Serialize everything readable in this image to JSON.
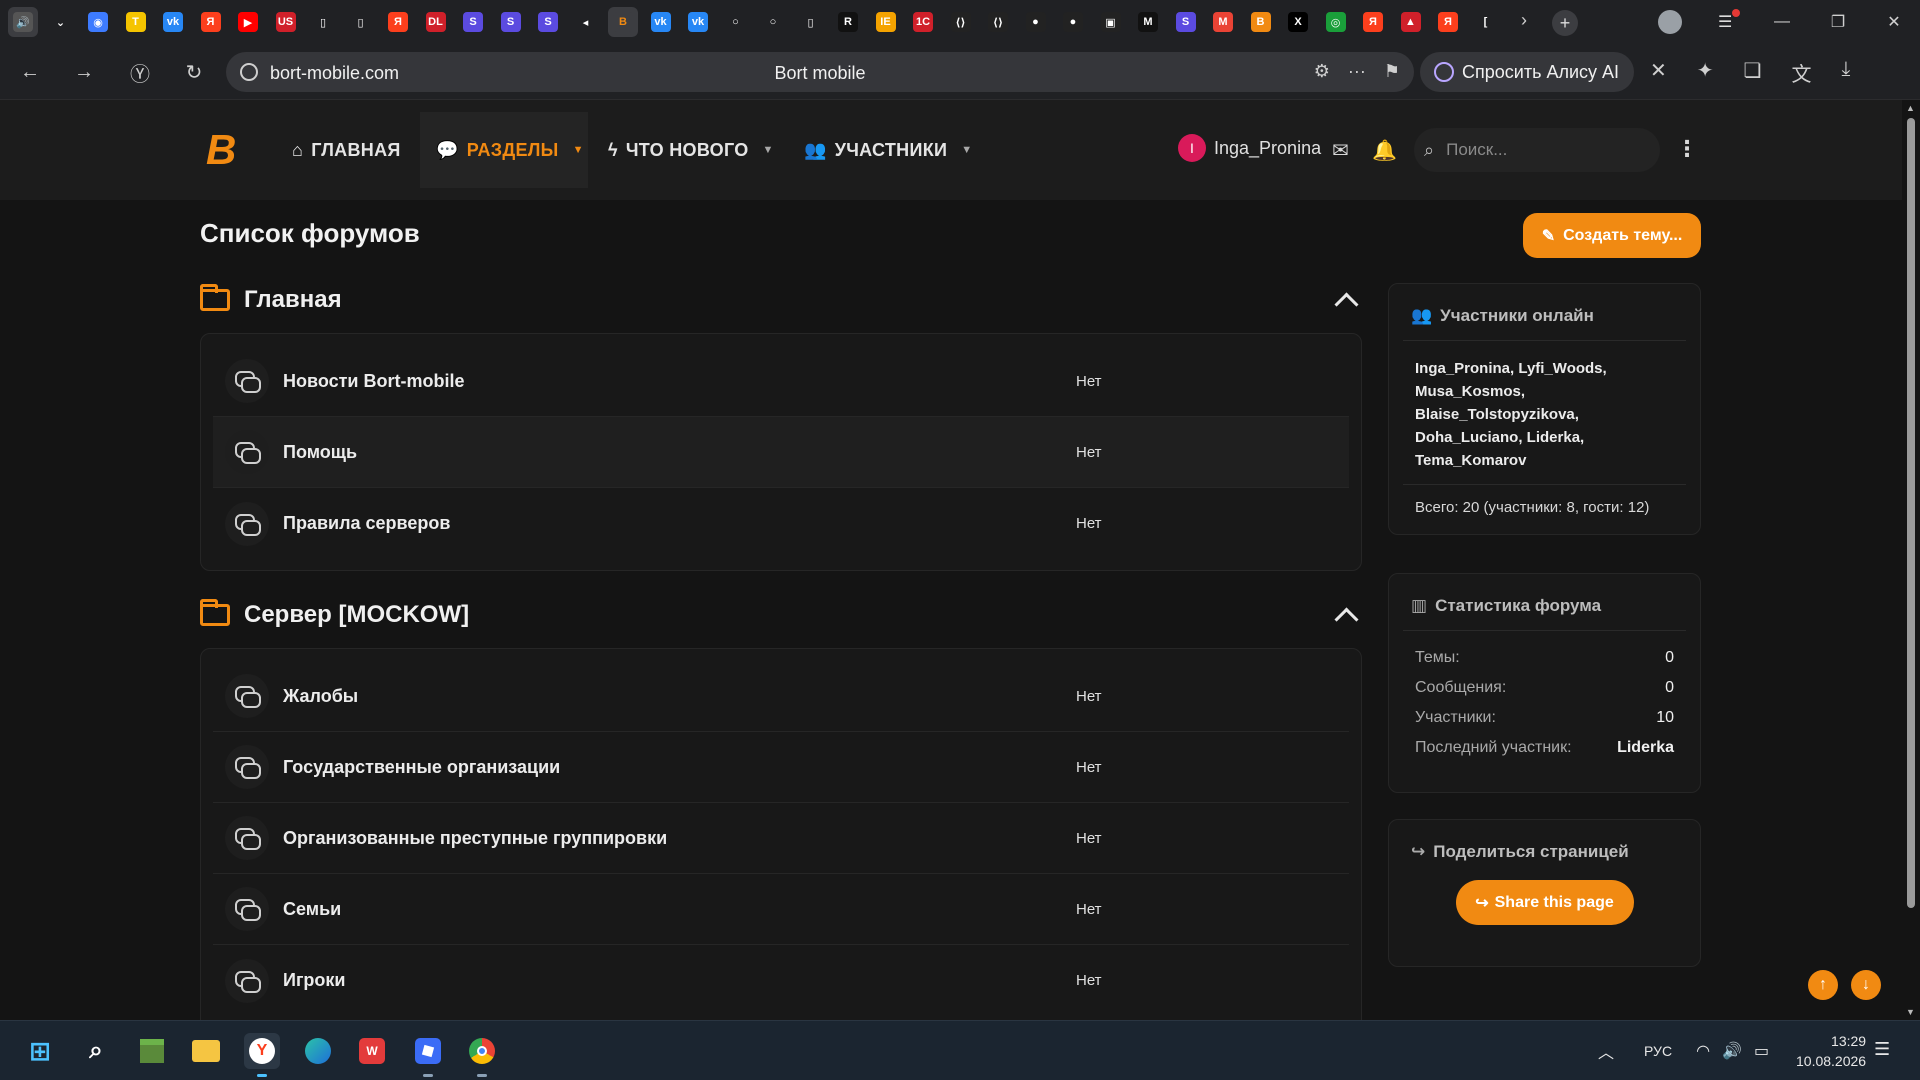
{
  "browser": {
    "url": "bort-mobile.com",
    "page_title": "Bort mobile",
    "alice_label": "Спросить Алису AI",
    "tabs": [
      {
        "icon": "speaker-tab-icon",
        "glyph": "🔊",
        "color": "#555"
      },
      {
        "icon": "tab-list-icon",
        "glyph": "⌄",
        "color": "transparent"
      },
      {
        "icon": "photo-app-icon",
        "glyph": "◉",
        "color": "#3d7bff"
      },
      {
        "icon": "t-app-icon",
        "glyph": "T",
        "color": "#f5c400"
      },
      {
        "icon": "vk-icon",
        "glyph": "vk",
        "color": "#2787f5"
      },
      {
        "icon": "yandex-icon",
        "glyph": "Я",
        "color": "#fc3f1d"
      },
      {
        "icon": "youtube-icon",
        "glyph": "▶",
        "color": "#ff0000"
      },
      {
        "icon": "us-icon",
        "glyph": "US",
        "color": "#d0202a"
      },
      {
        "icon": "doc-icon",
        "glyph": "▯",
        "color": "transparent"
      },
      {
        "icon": "doc-icon",
        "glyph": "▯",
        "color": "transparent"
      },
      {
        "icon": "yandex-icon",
        "glyph": "Я",
        "color": "#fc3f1d"
      },
      {
        "icon": "dl-icon",
        "glyph": "DL",
        "color": "#d0202a"
      },
      {
        "icon": "s-app-icon",
        "glyph": "S",
        "color": "#5b4be0"
      },
      {
        "icon": "s-app-icon",
        "glyph": "S",
        "color": "#5b4be0"
      },
      {
        "icon": "s-app-icon",
        "glyph": "S",
        "color": "#5b4be0"
      },
      {
        "icon": "audio-icon",
        "glyph": "◂",
        "color": "transparent"
      },
      {
        "icon": "bort-icon",
        "glyph": "B",
        "color": "#3c3d41"
      },
      {
        "icon": "vk-icon",
        "glyph": "vk",
        "color": "#2787f5"
      },
      {
        "icon": "vk-icon",
        "glyph": "vk",
        "color": "#2787f5"
      },
      {
        "icon": "loader-icon",
        "glyph": "○",
        "color": "transparent"
      },
      {
        "icon": "loader-icon",
        "glyph": "○",
        "color": "transparent"
      },
      {
        "icon": "doc-icon",
        "glyph": "▯",
        "color": "transparent"
      },
      {
        "icon": "r-icon",
        "glyph": "R",
        "color": "#111"
      },
      {
        "icon": "ie-icon",
        "glyph": "IE",
        "color": "#f5a300"
      },
      {
        "icon": "1c-icon",
        "glyph": "1C",
        "color": "#d0202a"
      },
      {
        "icon": "code-icon",
        "glyph": "⟨⟩",
        "color": "#222"
      },
      {
        "icon": "code-icon",
        "glyph": "⟨⟩",
        "color": "#222"
      },
      {
        "icon": "github-icon",
        "glyph": "●",
        "color": "#222"
      },
      {
        "icon": "github-icon",
        "glyph": "●",
        "color": "#222"
      },
      {
        "icon": "terminal-icon",
        "glyph": "▣",
        "color": "#222"
      },
      {
        "icon": "m-icon",
        "glyph": "M",
        "color": "#111"
      },
      {
        "icon": "s-app-icon",
        "glyph": "S",
        "color": "#5b4be0"
      },
      {
        "icon": "gmail-icon",
        "glyph": "M",
        "color": "#ea4335"
      },
      {
        "icon": "b-icon",
        "glyph": "B",
        "color": "#f18a12"
      },
      {
        "icon": "x-icon",
        "glyph": "X",
        "color": "#000"
      },
      {
        "icon": "circle-app-icon",
        "glyph": "◎",
        "color": "#1a9f3a"
      },
      {
        "icon": "yandex-icon",
        "glyph": "Я",
        "color": "#fc3f1d"
      },
      {
        "icon": "mountain-icon",
        "glyph": "▲",
        "color": "#d0202a"
      },
      {
        "icon": "yandex-icon",
        "glyph": "Я",
        "color": "#fc3f1d"
      },
      {
        "icon": "bracket-icon",
        "glyph": "[",
        "color": "transparent"
      }
    ]
  },
  "site": {
    "nav": {
      "home": "ГЛАВНАЯ",
      "sections": "РАЗДЕЛЫ",
      "whats_new": "ЧТО НОВОГО",
      "members": "УЧАСТНИКИ"
    },
    "user": {
      "name": "Inga_Pronina",
      "initial": "I"
    },
    "search_placeholder": "Поиск..."
  },
  "main": {
    "title": "Список форумов",
    "create_button": "Создать тему...",
    "categories": [
      {
        "title": "Главная",
        "forums": [
          {
            "name": "Новости Bort-mobile",
            "stat": "Нет"
          },
          {
            "name": "Помощь",
            "stat": "Нет"
          },
          {
            "name": "Правила серверов",
            "stat": "Нет"
          }
        ]
      },
      {
        "title": "Сервер [MOCKOW]",
        "forums": [
          {
            "name": "Жалобы",
            "stat": "Нет"
          },
          {
            "name": "Государственные организации",
            "stat": "Нет"
          },
          {
            "name": "Организованные преступные группировки",
            "stat": "Нет"
          },
          {
            "name": "Семьи",
            "stat": "Нет"
          },
          {
            "name": "Игроки",
            "stat": "Нет"
          }
        ]
      }
    ]
  },
  "sidebar": {
    "online": {
      "title": "Участники онлайн",
      "lines": [
        "Inga_Pronina, Lyfi_Woods,",
        "Musa_Kosmos,",
        "Blaise_Tolstopyzikova,",
        "Doha_Luciano, Liderka,",
        "Tema_Komarov"
      ],
      "total": "Всего: 20 (участники: 8, гости: 12)"
    },
    "stats": {
      "title": "Статистика форума",
      "rows": [
        {
          "label": "Темы:",
          "value": "0"
        },
        {
          "label": "Сообщения:",
          "value": "0"
        },
        {
          "label": "Участники:",
          "value": "10"
        },
        {
          "label": "Последний участник:",
          "value": "Liderka"
        }
      ]
    },
    "share": {
      "title": "Поделиться страницей",
      "button": "Share this page"
    }
  },
  "taskbar": {
    "lang": "РУС",
    "time": "13:29",
    "date": "10.08.2026"
  },
  "colors": {
    "accent": "#f18a12",
    "background": "#141414",
    "card": "#181818"
  }
}
